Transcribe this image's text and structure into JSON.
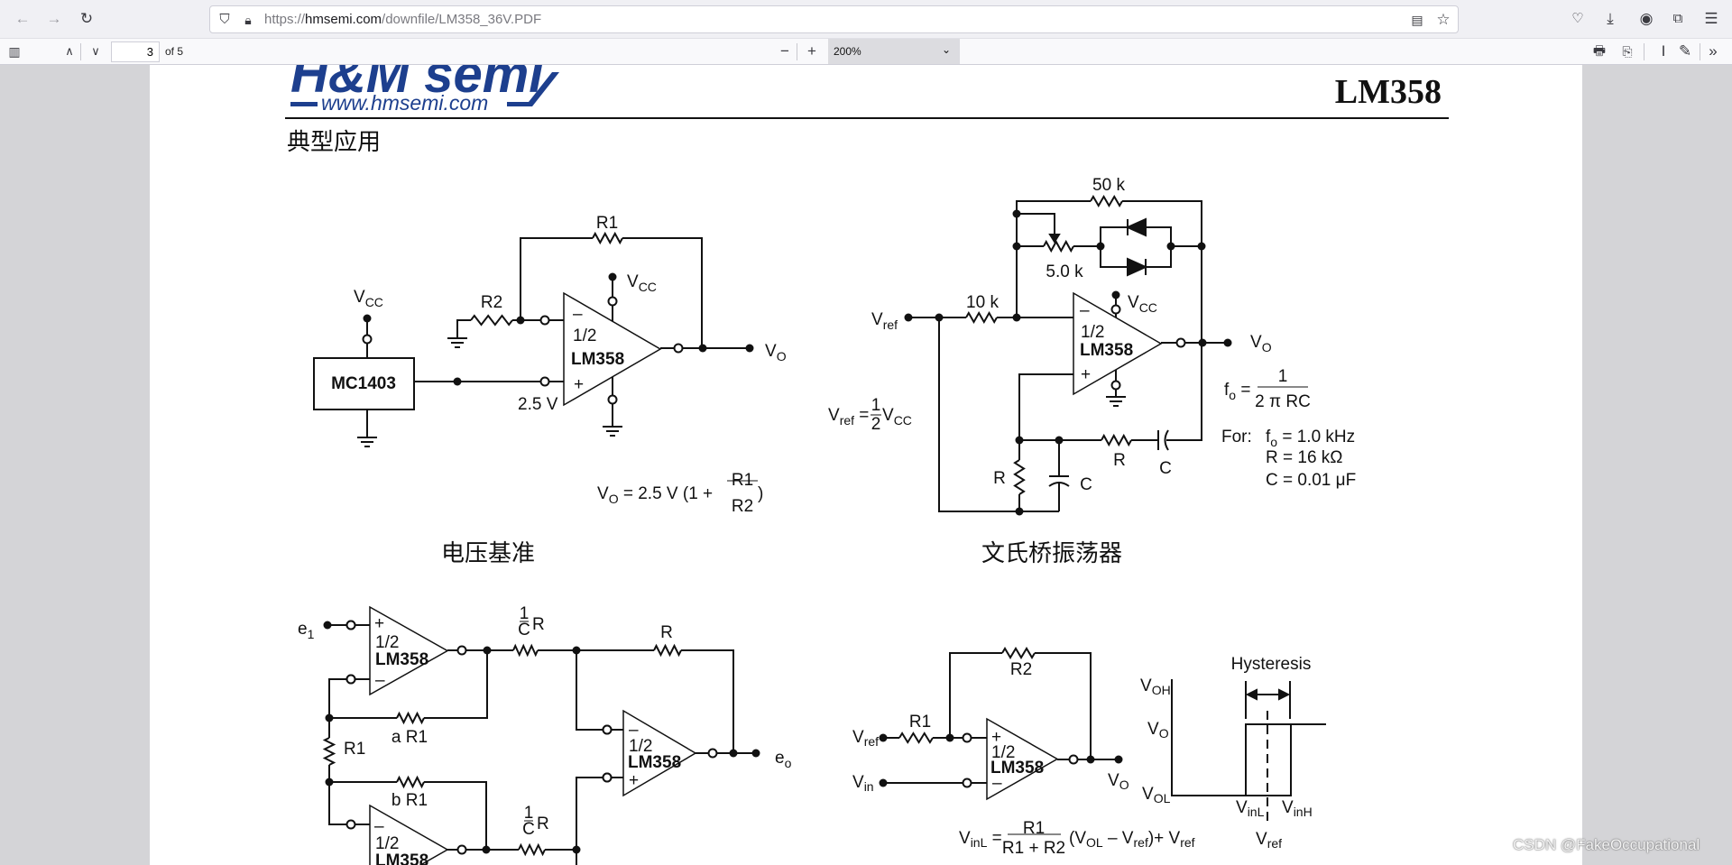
{
  "browser": {
    "url_prefix": "https://",
    "url_host": "hmsemi.com",
    "url_path": "/downfile/LM358_36V.PDF",
    "icons": [
      "back-icon",
      "forward-icon",
      "reload-icon",
      "shield-icon",
      "lock-icon",
      "reader-view-icon",
      "bookmark-star-icon",
      "pocket-icon",
      "download-icon",
      "account-icon",
      "extensions-icon",
      "menu-icon"
    ]
  },
  "pdf_toolbar": {
    "current_page": "3",
    "page_count_label": "of 5",
    "zoom": "200%",
    "icons": [
      "sidebar-toggle-icon",
      "previous-page-icon",
      "next-page-icon",
      "zoom-out-icon",
      "zoom-in-icon",
      "print-icon",
      "save-icon",
      "text-tool-icon",
      "draw-icon",
      "more-tools-icon"
    ]
  },
  "document": {
    "logo_main": "H&M semi",
    "logo_url": "www.hmsemi.com",
    "brand_color": "#1d3f8e",
    "part_title": "LM358",
    "section_title": "典型应用",
    "voltage_reference": {
      "caption": "电压基准",
      "vcc": "V",
      "cc": "CC",
      "r1": "R1",
      "r2": "R2",
      "half": "1/2",
      "chip": "LM358",
      "minus": "–",
      "plus": "+",
      "ref_chip": "MC1403",
      "v25": "2.5 V",
      "vo": "V",
      "o": "O",
      "formula_mid": " =  2.5 V (1 + ",
      "formula_num": "R1",
      "formula_den": "R2",
      "formula_end": " )"
    },
    "wien_bridge": {
      "caption": "文氏桥振荡器",
      "r50k": "50 k",
      "r5k": "5.0 k",
      "r10k": "10 k",
      "vref": "V",
      "ref": "ref",
      "vcc": "V",
      "cc": "CC",
      "half": "1/2",
      "chip": "LM358",
      "minus": "–",
      "plus": "+",
      "vo": "V",
      "o": "O",
      "r": "R",
      "c": "C",
      "vref_eq": " = ",
      "vref_num": "1",
      "vref_den": "2",
      "vref_vcc": " V",
      "f": "f",
      "f0": "o",
      "f_eq": " = ",
      "f_num": "1",
      "f_den": "2 π RC",
      "for": "For:",
      "for_f": " = 1.0 kHz",
      "for_r": "R = 16 kΩ",
      "for_c": "C = 0.01 μF"
    },
    "instrumentation_amp": {
      "e1": "e",
      "e1_sub": "1",
      "eo": "e",
      "eo_sub": "o",
      "half": "1/2",
      "chip": "LM358",
      "minus": "–",
      "plus": "+",
      "one": "1",
      "c": "C",
      "r": "R",
      "ar1": "a R1",
      "br1": "b R1",
      "r1": "R1"
    },
    "comparator": {
      "r1": "R1",
      "r2": "R2",
      "v": "V",
      "ref": "ref",
      "in": "in",
      "o": "O",
      "oh": "OH",
      "ol": "OL",
      "inl": "inL",
      "inh": "inH",
      "half": "1/2",
      "chip": "LM358",
      "minus": "–",
      "plus": "+",
      "hysteresis": "Hysteresis",
      "formula_eq": " = ",
      "formula_num": "R1",
      "formula_den": "R1 + R2",
      "formula_paren_open": "(V",
      "formula_minus": " – V",
      "formula_close": ")+ V"
    }
  },
  "watermark": "CSDN @FakeOccupational"
}
